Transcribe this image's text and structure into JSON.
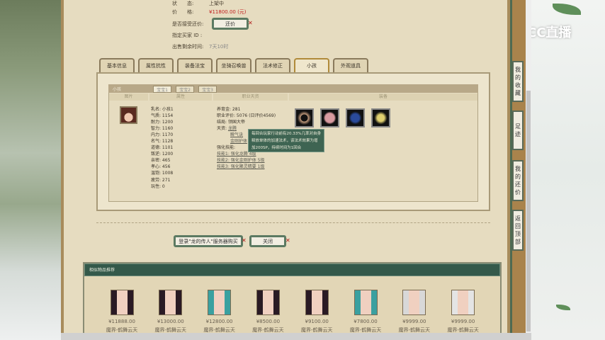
{
  "info": {
    "status_label": "状　　态:",
    "status_value": "上架中",
    "price_label": "价　　格:",
    "price_value": "¥11800.00 (元)",
    "counter_label": "是否接受还价:",
    "counter_button": "还价",
    "buyer_label": "指定买家 ID :",
    "time_label": "出售剩余时间:",
    "time_value": "7天10时"
  },
  "tabs": [
    "基本信息",
    "属性抗性",
    "装备法宝",
    "坐骑召唤兽",
    "法术修正",
    "小孩",
    "外观道具"
  ],
  "active_tab": "小孩",
  "child_panel": {
    "title": "小孩",
    "subtabs": [
      "宝宝1",
      "宝宝2",
      "宝宝3"
    ],
    "columns": [
      "图片",
      "属性",
      "职业天资",
      "装备"
    ],
    "attributes": [
      "乳名: 小孩1",
      "气质: 1154",
      "耐力: 1200",
      "智力: 1160",
      "内力: 1170",
      "名气: 1128",
      "道德: 1101",
      "叛逆: 1200",
      "亲密: 465",
      "孝心: 456",
      "温饱: 1008",
      "疲劳: 271",
      "玩性: 0"
    ],
    "career": {
      "money": "养育金: 281",
      "rating": "职业评价: 5076 (日评价4569)",
      "ending": "结局: 领国大帝",
      "talent_label": "天资:",
      "talents": [
        "龙腾",
        "瞬气诀",
        "金刚护体"
      ],
      "skills_label": "强化技能:",
      "skills": [
        "技能1: 强化龙腾 4级",
        "技能2: 强化金刚护体 5级",
        "技能3: 强化聚灵精要 1级"
      ]
    },
    "equipment": [
      "bracelet-item",
      "robe-item",
      "armor-item",
      "shoes-item"
    ],
    "tooltip": "每回合玩家行动前有20.33%几率对自身释放单体的加速法术，该法术效果为增加200SP，持续时间为1回合"
  },
  "actions": {
    "login_button": "登录\"龙的传人\"服务器购买",
    "close_button": "关闭"
  },
  "sidebar": [
    "我的收藏",
    "足迹",
    "我的还价",
    "返回顶部"
  ],
  "logo": "CC直播",
  "recommend": {
    "title": "相似物品推荐",
    "items": [
      {
        "price": "¥11888.00",
        "name": "魔界-鹤舞云天",
        "hair": "#2a1a24"
      },
      {
        "price": "¥13000.00",
        "name": "魔界-鹤舞云天",
        "hair": "#2a1a24"
      },
      {
        "price": "¥12800.00",
        "name": "魔界-鹤舞云天",
        "hair": "#3aa0a0"
      },
      {
        "price": "¥8500.00",
        "name": "魔界-鹤舞云天",
        "hair": "#2a1a24"
      },
      {
        "price": "¥9100.00",
        "name": "魔界-鹤舞云天",
        "hair": "#2a1a24"
      },
      {
        "price": "¥7800.00",
        "name": "魔界-鹤舞云天",
        "hair": "#3aa0a0"
      },
      {
        "price": "¥9999.00",
        "name": "魔界-鹤舞云天",
        "hair": "#d8d8d8"
      },
      {
        "price": "¥9999.00",
        "name": "魔界-鹤舞云天",
        "hair": "#e4e4e4"
      }
    ]
  }
}
